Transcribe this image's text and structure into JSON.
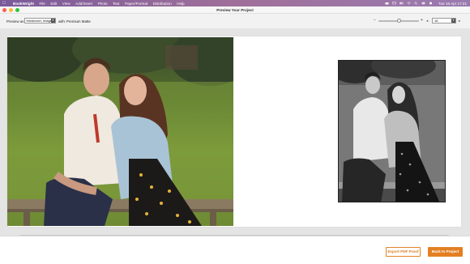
{
  "menubar": {
    "app_name": "BookWright",
    "items": [
      "File",
      "Edit",
      "View",
      "Add/Insert",
      "Photo",
      "Text",
      "Paper/Format",
      "Distribution",
      "Help"
    ],
    "clock": "Tue 15 Apr  17:21"
  },
  "window": {
    "title": "Preview Your Project"
  },
  "toolbar": {
    "preview_as_label": "Preview as",
    "preview_as_value": "Hardcover, ImageW",
    "with_label": "with:",
    "with_value": "Premium Matte",
    "zoom_minus": "−",
    "zoom_plus": "+",
    "zoom_level": 0.5,
    "page_value": "16"
  },
  "preview": {
    "left_photo": "couple-sitting-on-bench-color-photo",
    "right_photo": "couple-sitting-on-bench-black-and-white-photo"
  },
  "buttons": {
    "export_pdf": "Export PDF Proof",
    "back": "Back to Project"
  },
  "colors": {
    "accent": "#e37f22",
    "menubar": "#8f6aa0"
  }
}
